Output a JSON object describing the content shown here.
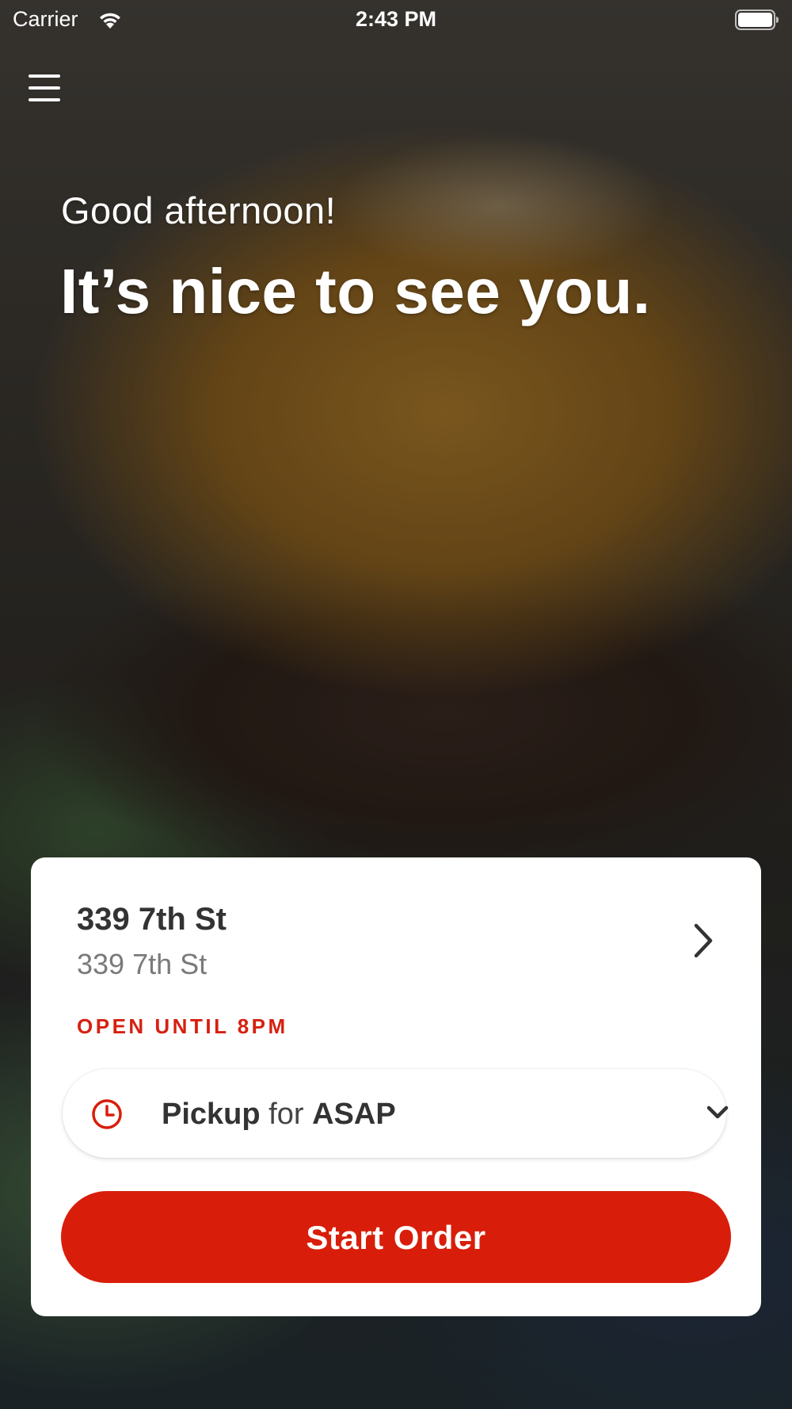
{
  "status_bar": {
    "carrier": "Carrier",
    "time": "2:43 PM",
    "wifi_icon": "wifi-icon",
    "battery_icon": "battery-icon"
  },
  "header": {
    "menu_icon": "hamburger-menu-icon"
  },
  "hero": {
    "greeting": "Good afternoon!",
    "headline": "It’s nice to see you."
  },
  "location_card": {
    "name": "339 7th St",
    "address": "339 7th St",
    "hours": "OPEN UNTIL 8PM",
    "chevron_icon": "chevron-right-icon",
    "order_mode": {
      "icon": "clock-icon",
      "mode": "Pickup",
      "connector": "for",
      "time": "ASAP",
      "caret_icon": "chevron-down-icon"
    },
    "start_button": "Start Order"
  },
  "colors": {
    "accent": "#d81e0a",
    "hours_text": "#d62010",
    "card_bg": "#ffffff",
    "primary_text": "#333333",
    "secondary_text": "#7a7a7a"
  }
}
